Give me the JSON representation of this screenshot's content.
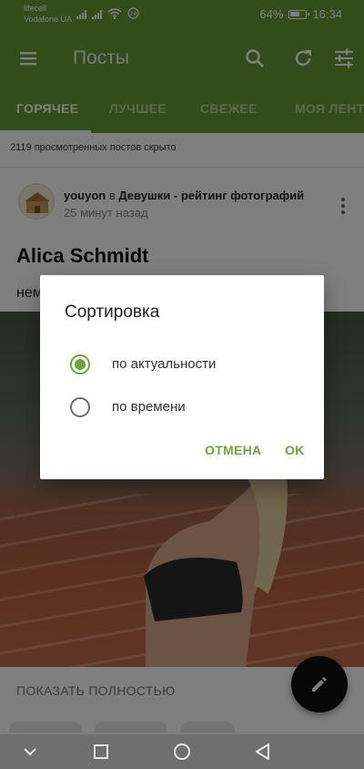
{
  "status_bar": {
    "carrier1": "lifecell",
    "carrier2": "Vodafone UA",
    "battery_pct": "64%",
    "time": "16:34",
    "icons": [
      "signal-icon",
      "signal-icon",
      "wifi-icon",
      "data-saver-icon",
      "battery-icon"
    ]
  },
  "app_bar": {
    "title": "Посты",
    "icons": [
      "menu-icon",
      "search-icon",
      "refresh-icon",
      "filter-icon"
    ]
  },
  "tabs": [
    {
      "label": "ГОРЯЧЕЕ",
      "active": true
    },
    {
      "label": "ЛУЧШЕЕ",
      "active": false
    },
    {
      "label": "СВЕЖЕЕ",
      "active": false
    },
    {
      "label": "МОЯ ЛЕНТА",
      "active": false
    }
  ],
  "feed": {
    "hidden_note": "2119 просмотренных постов скрыто",
    "post": {
      "author": "youyon",
      "in_word": "в",
      "community": "Девушки - рейтинг фотографий",
      "time": "25 минут назад",
      "title": "Alica Schmidt",
      "text": "нем",
      "show_full": "ПОКАЗАТЬ ПОЛНОСТЬЮ"
    }
  },
  "dialog": {
    "title": "Сортировка",
    "options": [
      {
        "label": "по актуальности",
        "selected": true
      },
      {
        "label": "по времени",
        "selected": false
      }
    ],
    "cancel_label": "ОТМЕНА",
    "ok_label": "OK"
  },
  "colors": {
    "header_green": "#669b34",
    "accent_green": "#6fa33c",
    "fab": "#111111"
  },
  "nav_bar": {
    "icons": [
      "collapse-icon",
      "recents-icon",
      "home-icon",
      "back-icon"
    ]
  }
}
